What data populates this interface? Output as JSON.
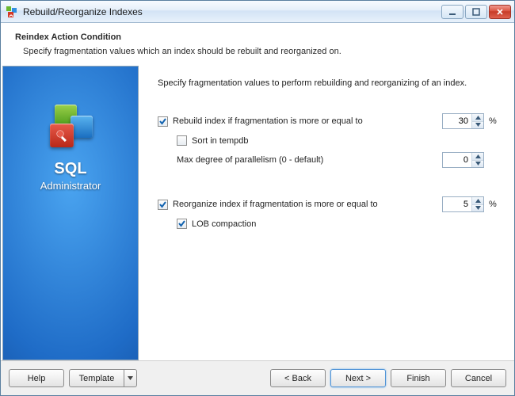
{
  "window": {
    "title": "Rebuild/Reorganize Indexes"
  },
  "header": {
    "title": "Reindex Action Condition",
    "description": "Specify fragmentation values which an index should be rebuilt and reorganized on."
  },
  "sidebar": {
    "brand_line1": "SQL",
    "brand_line2": "Administrator"
  },
  "main": {
    "intro": "Specify fragmentation values to perform rebuilding and reorganizing of an index.",
    "rebuild": {
      "enabled": true,
      "label": "Rebuild index if fragmentation is more or equal to",
      "value": "30",
      "unit": "%",
      "sort_tempdb": {
        "enabled": false,
        "label": "Sort in tempdb"
      },
      "maxdop": {
        "label": "Max degree of parallelism (0 - default)",
        "value": "0"
      }
    },
    "reorganize": {
      "enabled": true,
      "label": "Reorganize index if fragmentation is more or equal to",
      "value": "5",
      "unit": "%",
      "lob": {
        "enabled": true,
        "label": "LOB compaction"
      }
    }
  },
  "footer": {
    "help": "Help",
    "template": "Template",
    "back": "< Back",
    "next": "Next >",
    "finish": "Finish",
    "cancel": "Cancel"
  }
}
